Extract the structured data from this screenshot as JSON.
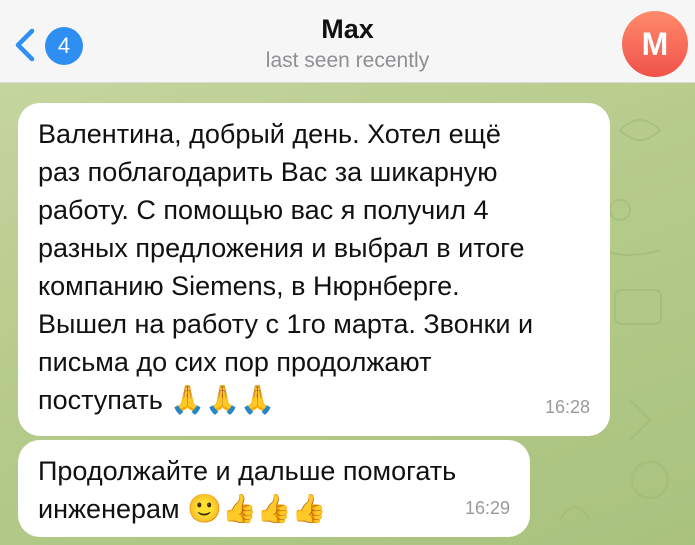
{
  "header": {
    "title": "Max",
    "status": "last seen recently",
    "unread_count": "4",
    "avatar_initial": "M",
    "back_icon": "chevron-left-icon"
  },
  "colors": {
    "header_bg": "#f6f6f6",
    "accent": "#2f8ef2",
    "avatar_top": "#ff8a6a",
    "avatar_bottom": "#f0524b",
    "bubble_bg": "#ffffff",
    "chat_bg": "#b7cc8c"
  },
  "messages": [
    {
      "text": "Валентина, добрый день. Хотел ещё\nраз поблагодарить Вас за шикарную\nработу. С помощью вас я получил 4\nразных предложения и выбрал в итоге\nкомпанию Siemens, в Нюрнберге.\nВышел на работу с 1го марта. Звонки и\nписьма до сих пор продолжают\nпоступать ",
      "emoji": "🙏🙏🙏",
      "time": "16:28"
    },
    {
      "text": "Продолжайте и дальше помогать\nинженерам ",
      "emoji": "🙂👍👍👍",
      "time": "16:29"
    }
  ]
}
